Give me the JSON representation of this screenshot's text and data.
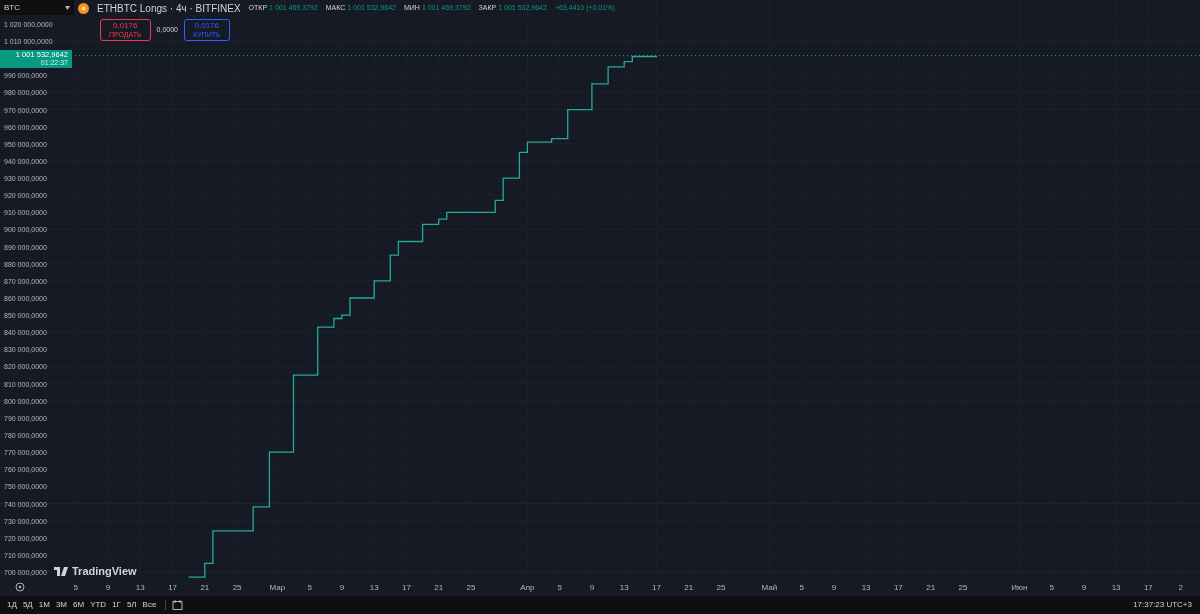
{
  "symbol_select": {
    "value": "BTC"
  },
  "legend": {
    "title": "ETHBTC Longs · 4ч · BITFINEX",
    "ohlc": [
      {
        "label": "ОТКР",
        "value": "1 001 469,3792"
      },
      {
        "label": "МАКС",
        "value": "1 001 532,9642"
      },
      {
        "label": "МИН",
        "value": "1 001 469,3792"
      },
      {
        "label": "ЗАКР",
        "value": "1 001 532,9642"
      }
    ],
    "change": "+63,4410 (+0,01%)"
  },
  "trade": {
    "sell": {
      "price": "0,0176",
      "label": "ПРОДАТЬ"
    },
    "spread": "0,0000",
    "buy": {
      "price": "0,0176",
      "label": "КУПИТЬ"
    }
  },
  "price_tag": {
    "price": "1 001 532,9642",
    "countdown": "01:22:37"
  },
  "watermark_logo": "TradingView",
  "price_axis": {
    "labels": [
      "1 020 000,0000",
      "1 010 000,0000",
      "990 000,0000",
      "980 000,0000",
      "970 000,0000",
      "960 000,0000",
      "950 000,0000",
      "940 000,0000",
      "930 000,0000",
      "920 000,0000",
      "910 000,0000",
      "900 000,0000",
      "890 000,0000",
      "880 000,0000",
      "870 000,0000",
      "860 000,0000",
      "850 000,0000",
      "840 000,0000",
      "830 000,0000",
      "820 000,0000",
      "810 000,0000",
      "800 000,0000",
      "790 000,0000",
      "780 000,0000",
      "770 000,0000",
      "760 000,0000",
      "750 000,0000",
      "740 000,0000",
      "730 000,0000",
      "720 000,0000",
      "710 000,0000",
      "700 000,0000"
    ]
  },
  "time_axis": {
    "labels": [
      "5",
      "9",
      "13",
      "17",
      "21",
      "25",
      "Мар",
      "5",
      "9",
      "13",
      "17",
      "21",
      "25",
      "Апр",
      "5",
      "9",
      "13",
      "17",
      "21",
      "25",
      "Май",
      "5",
      "9",
      "13",
      "17",
      "21",
      "25",
      "Июн",
      "5",
      "9",
      "13",
      "17",
      "2"
    ]
  },
  "ranges": [
    {
      "label": "1Д"
    },
    {
      "label": "5Д"
    },
    {
      "label": "1М"
    },
    {
      "label": "3М"
    },
    {
      "label": "6М"
    },
    {
      "label": "YTD"
    },
    {
      "label": "1Г"
    },
    {
      "label": "5Л"
    },
    {
      "label": "Все"
    }
  ],
  "clock": "17:37:23 UTC+3"
}
